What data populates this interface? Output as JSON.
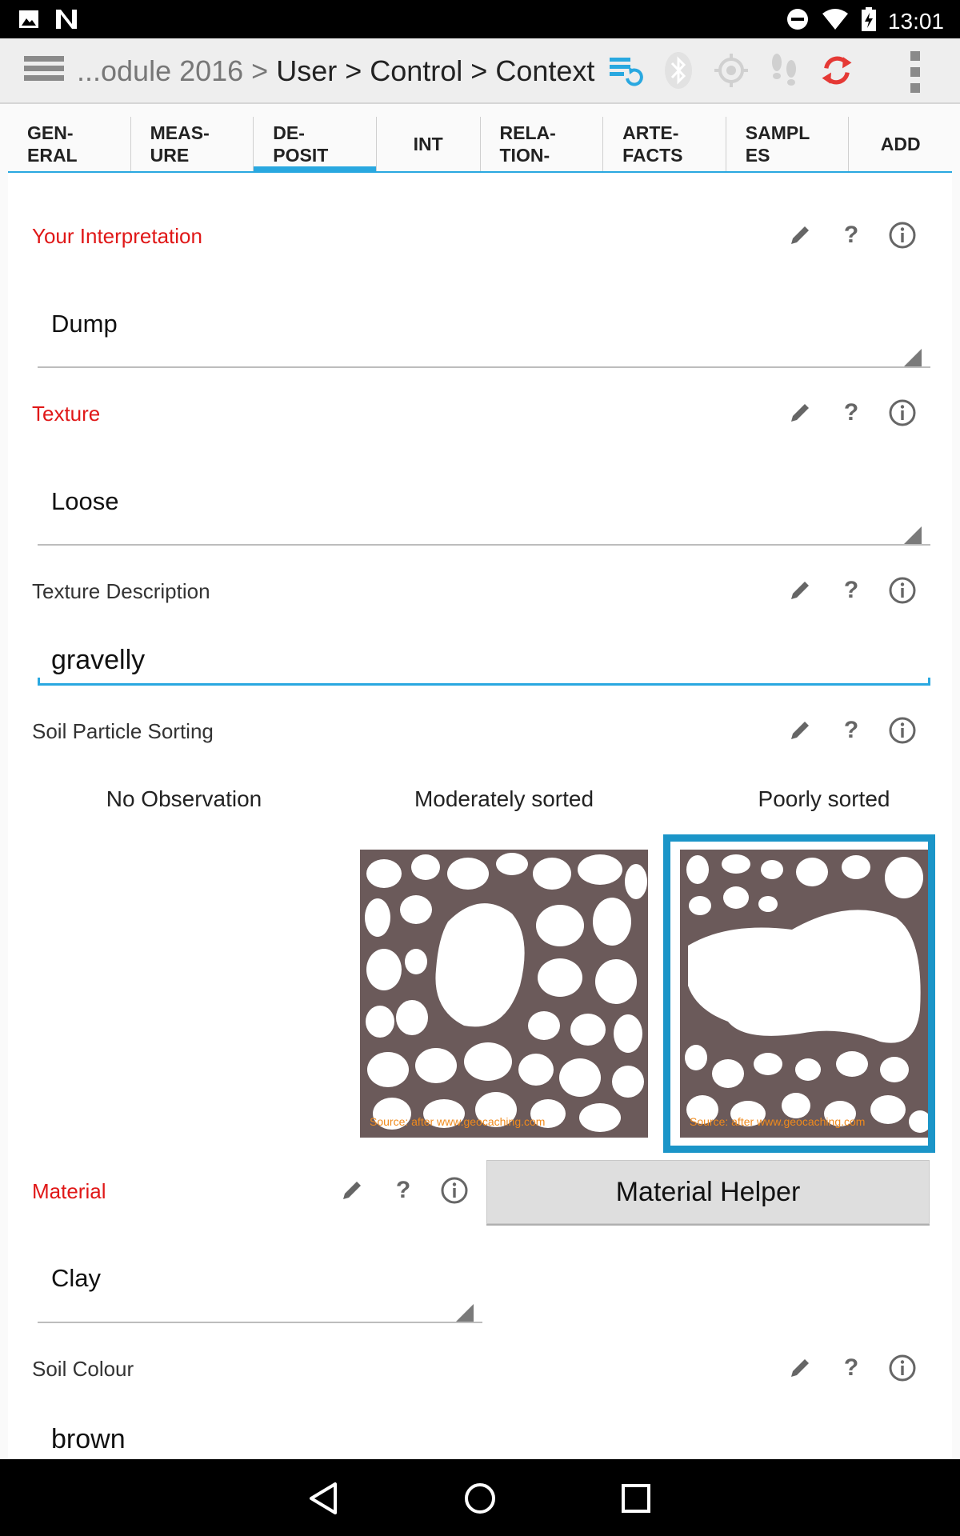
{
  "status_bar": {
    "time": "13:01",
    "icons": [
      "image-icon",
      "n-logo-icon",
      "do-not-disturb-icon",
      "wifi-icon",
      "battery-charging-icon"
    ]
  },
  "action_bar": {
    "breadcrumb_prefix": "...odule 2016 >",
    "breadcrumb_rest": " User > Control > Context",
    "icons": [
      "menu-icon",
      "sync-list-icon",
      "bluetooth-icon",
      "gps-icon",
      "footsteps-icon",
      "refresh-icon",
      "overflow-menu-icon"
    ],
    "colors": {
      "sync": "#29a8e0",
      "refresh": "#e53935",
      "disabled": "#c8c8c8"
    }
  },
  "tabs": [
    {
      "line1": "GEN-",
      "line2": "ERAL"
    },
    {
      "line1": "MEAS-",
      "line2": "URE"
    },
    {
      "line1": "DE-",
      "line2": "POSIT",
      "active": true
    },
    {
      "line1": "INT",
      "line2": ""
    },
    {
      "line1": "RELA-",
      "line2": "TION-"
    },
    {
      "line1": "ARTE-",
      "line2": "FACTS"
    },
    {
      "line1": "SAMPL",
      "line2": "ES"
    },
    {
      "line1": "ADD",
      "line2": ""
    }
  ],
  "fields": {
    "interpretation": {
      "label": "Your Interpretation",
      "value": "Dump"
    },
    "texture": {
      "label": "Texture",
      "value": "Loose"
    },
    "texture_description": {
      "label": "Texture Description",
      "value": "gravelly"
    },
    "soil_sorting": {
      "label": "Soil Particle Sorting",
      "options": [
        "No Observation",
        "Moderately sorted",
        "Poorly sorted"
      ],
      "selected": "Poorly sorted",
      "image_source": "Source: after www.geocaching.com"
    },
    "material": {
      "label": "Material",
      "value": "Clay",
      "helper_button": "Material Helper"
    },
    "soil_colour": {
      "label": "Soil Colour",
      "value": "brown"
    }
  },
  "row_icons": {
    "edit": "pencil-icon",
    "help": "?",
    "info": "i"
  },
  "colors": {
    "required_label": "#e01818",
    "accent": "#29a8e0",
    "selection": "#1b95c8",
    "soil": "#6b5a5a"
  },
  "nav_bar": {
    "icons": [
      "back-icon",
      "home-icon",
      "recents-icon"
    ]
  }
}
